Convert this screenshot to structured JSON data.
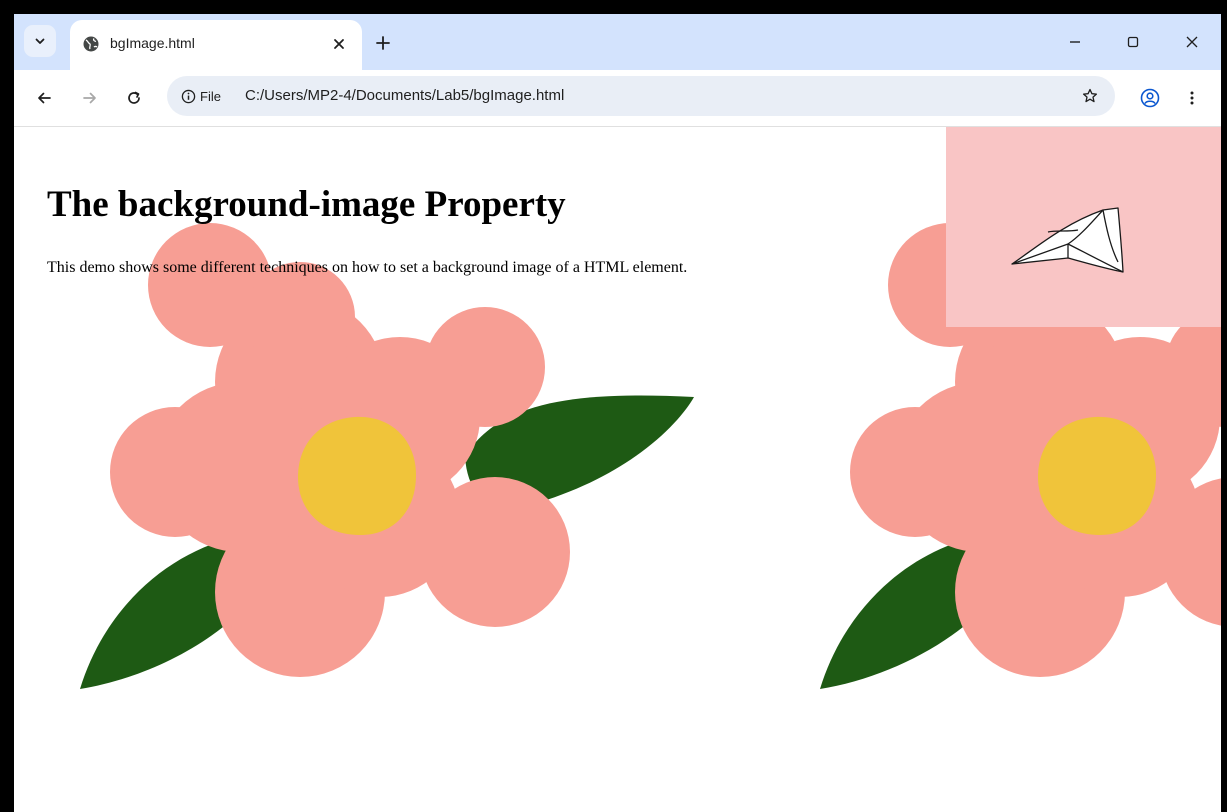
{
  "browser": {
    "tab": {
      "title": "bgImage.html",
      "icon": "globe-icon"
    },
    "address_bar": {
      "security_chip_label": "File",
      "url": "C:/Users/MP2-4/Documents/Lab5/bgImage.html"
    },
    "icons": {
      "tab_menu": "chevron-down-icon",
      "close_tab": "close-icon",
      "new_tab": "plus-icon",
      "minimize": "minimize-icon",
      "maximize": "maximize-icon",
      "close_window": "close-icon",
      "back": "back-arrow-icon",
      "forward": "forward-arrow-icon",
      "reload": "reload-icon",
      "info": "info-icon",
      "bookmark": "star-icon",
      "profile": "profile-icon",
      "menu": "more-vert-icon"
    }
  },
  "page": {
    "heading": "The background-image Property",
    "paragraph": "This demo shows some different techniques on how to set a background image of a HTML element."
  },
  "colors": {
    "titlebar": "#d3e3fd",
    "omnibox": "#e9eef6",
    "petal": "#f79e94",
    "flower_center": "#f0c43a",
    "leaf": "#1e5a14",
    "corner_box": "#f9c5c5"
  }
}
